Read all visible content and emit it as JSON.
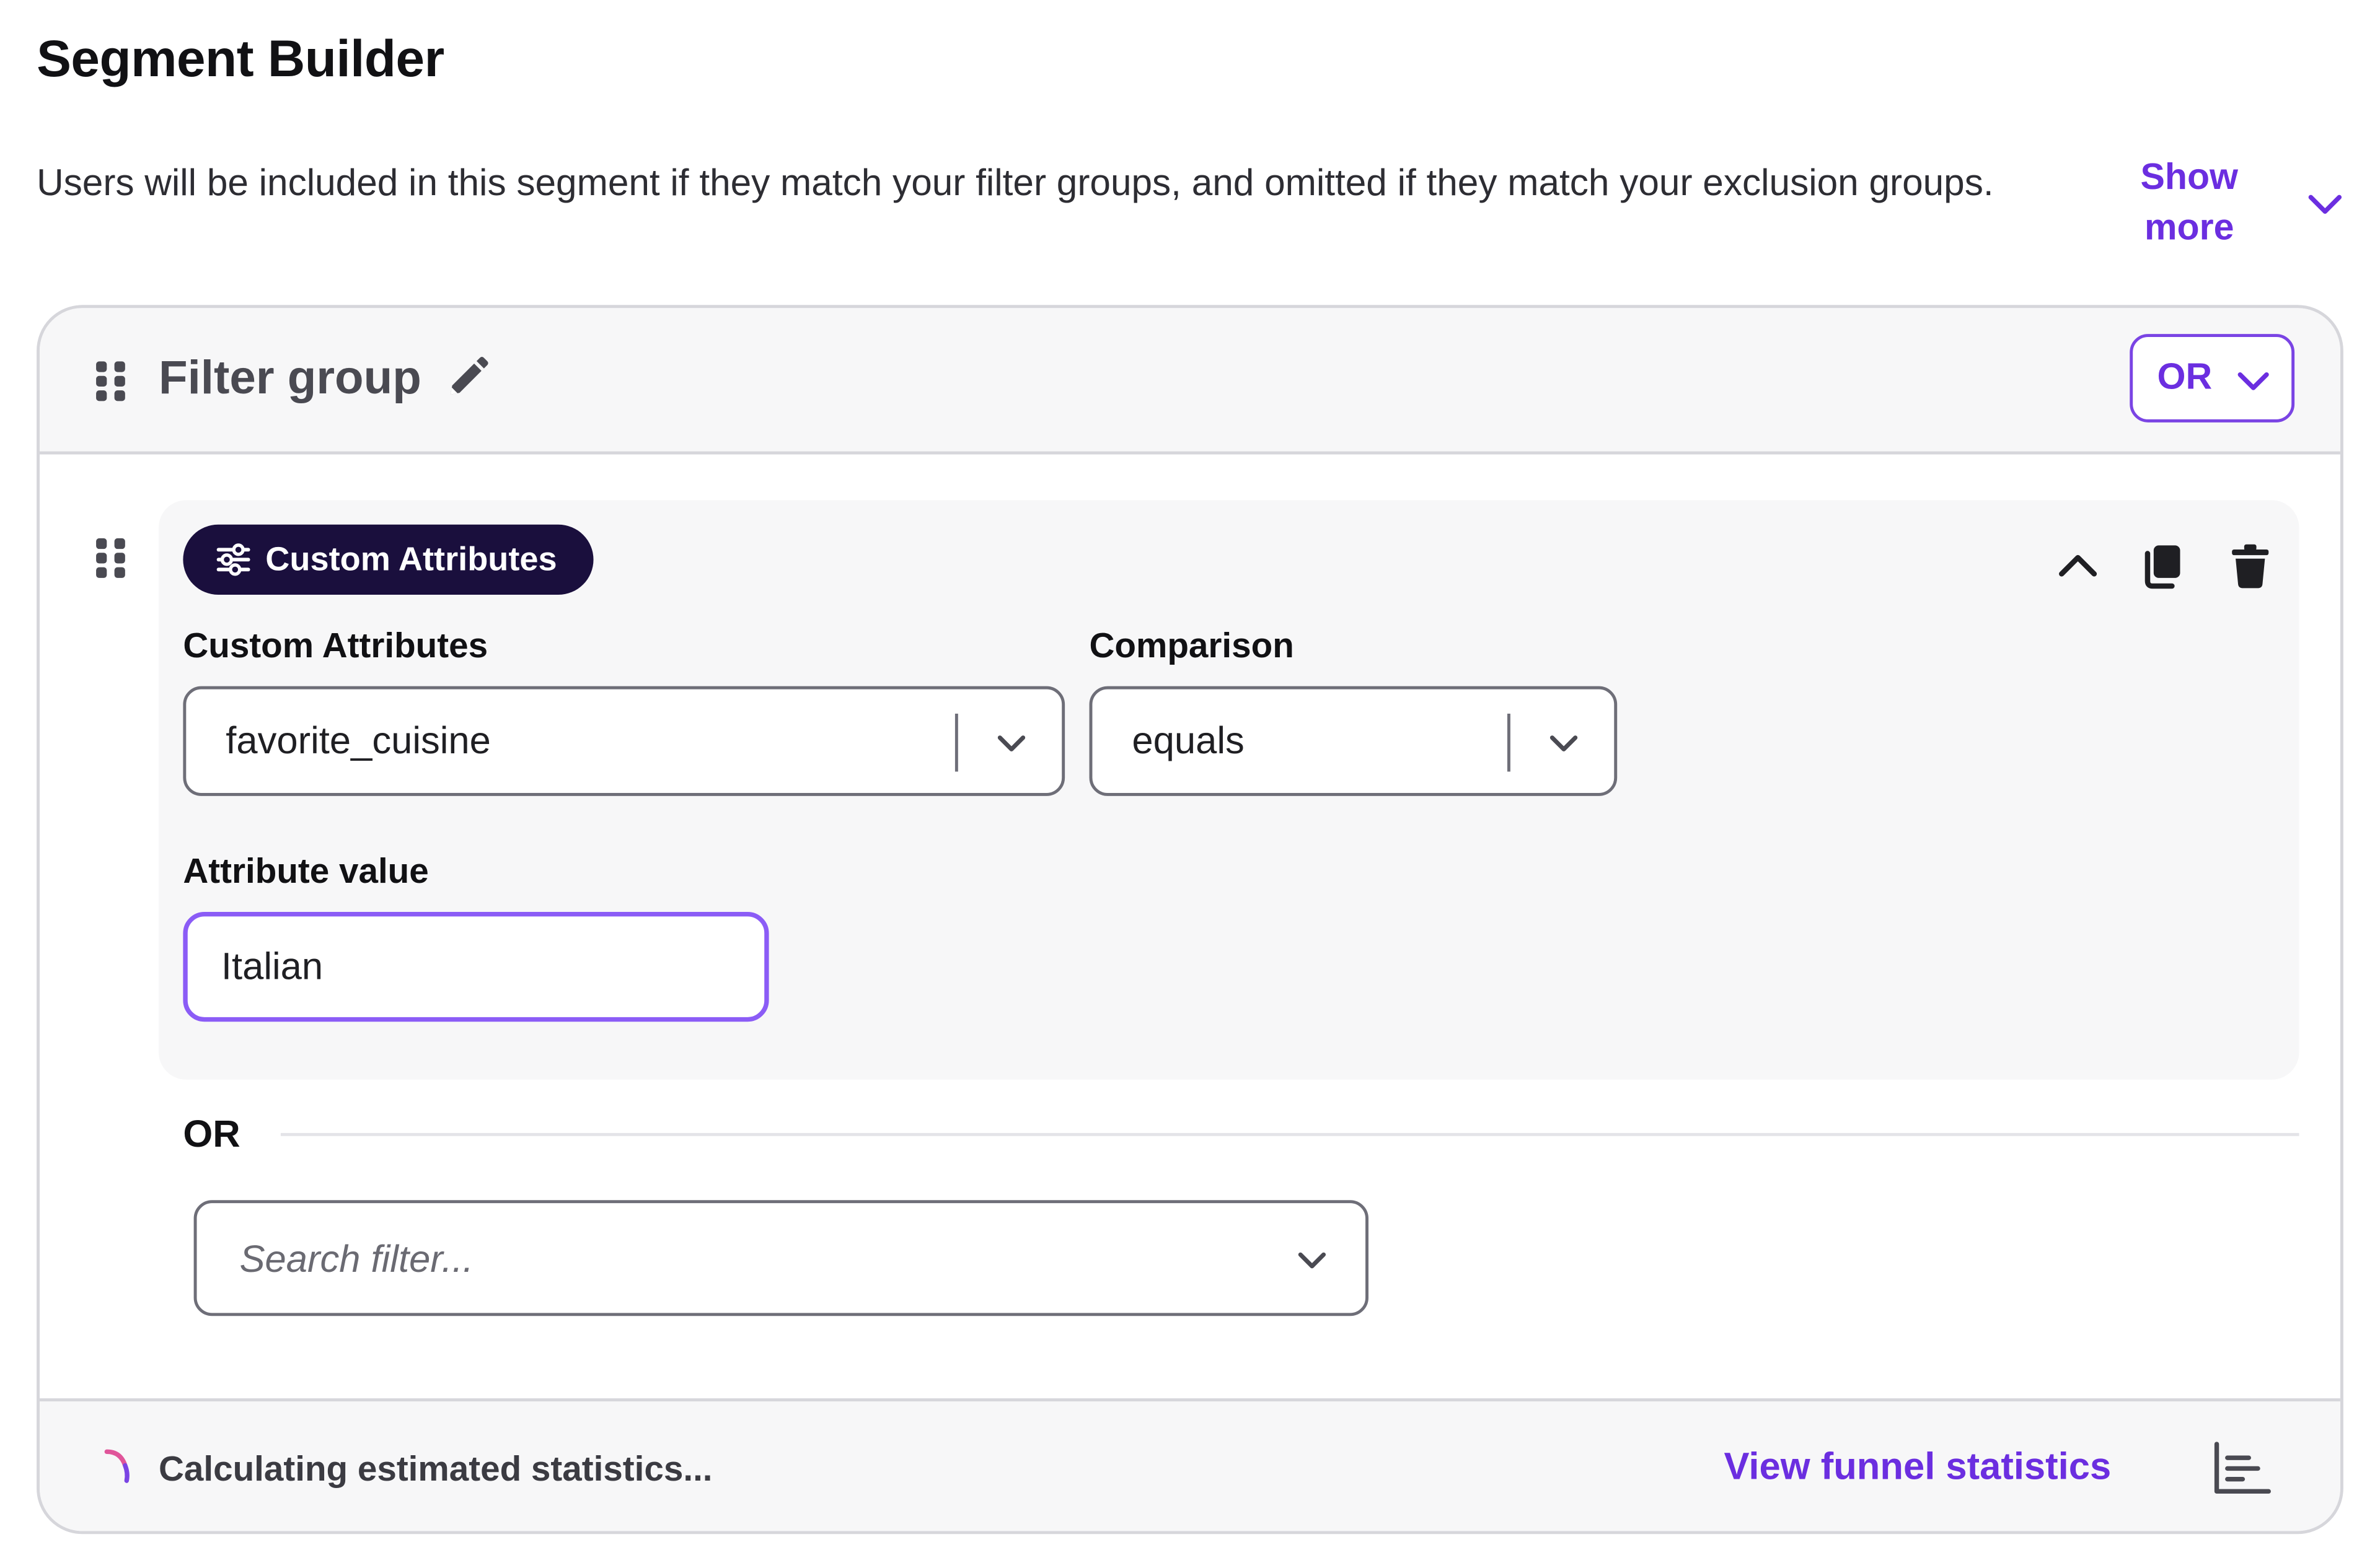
{
  "page": {
    "title": "Segment Builder",
    "description": "Users will be included in this segment if they match your filter groups, and omitted if they match your exclusion groups.",
    "show_more_label": "Show more"
  },
  "filter_group": {
    "title": "Filter group",
    "operator": "OR",
    "filter": {
      "type_label": "Custom Attributes",
      "attribute_label": "Custom Attributes",
      "attribute_value": "favorite_cuisine",
      "comparison_label": "Comparison",
      "comparison_value": "equals",
      "value_label": "Attribute value",
      "value": "Italian"
    },
    "separator_label": "OR",
    "search": {
      "placeholder": "Search filter..."
    }
  },
  "footer": {
    "status": "Calculating estimated statistics...",
    "funnel_link": "View funnel statistics"
  },
  "icons": {
    "drag": "drag-handle-icon",
    "edit": "pencil-icon",
    "chevron": "chevron-down-icon",
    "collapse": "chevron-up-icon",
    "copy": "copy-icon",
    "delete": "trash-icon",
    "filter_type": "sliders-icon",
    "spinner": "loading-spinner-icon",
    "funnel": "bar-chart-icon"
  },
  "colors": {
    "accent": "#6b2ee0",
    "focus_border": "#8b5cf6",
    "pill_background": "#1a0f3d",
    "panel_background": "#f7f7f8",
    "border": "#d6d6db"
  }
}
